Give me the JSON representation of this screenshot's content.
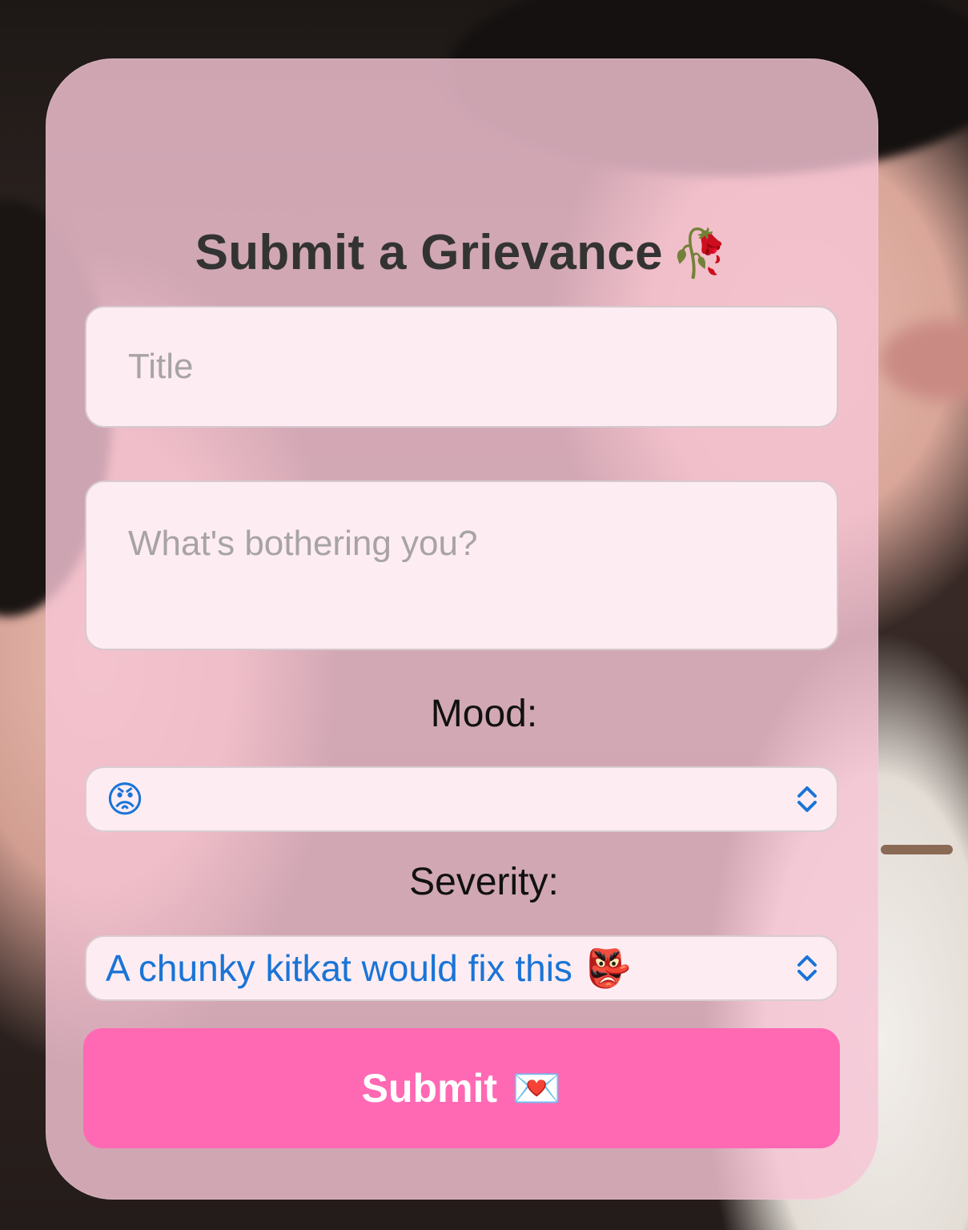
{
  "form": {
    "title": "Submit a Grievance",
    "title_icon": "🥀",
    "title_input_placeholder": "Title",
    "description_placeholder": "What's bothering you?",
    "mood_label": "Mood:",
    "mood_value": "😡",
    "severity_label": "Severity:",
    "severity_value_text": "A chunky kitkat would fix this",
    "severity_value_icon": "👺",
    "submit_label": "Submit",
    "submit_icon": "💌"
  },
  "colors": {
    "card_background": "#f5c4d4",
    "input_background": "#fdedf3",
    "submit_background": "#ff69b4",
    "select_text": "#1a74d6",
    "title_text": "#333333"
  }
}
